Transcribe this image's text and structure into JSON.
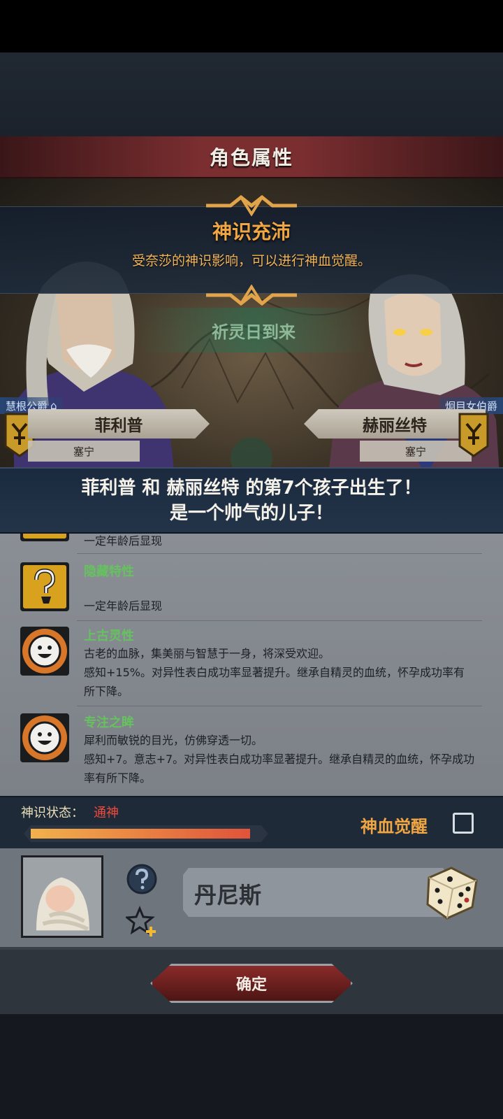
{
  "header": {
    "title": "角色属性"
  },
  "banner": {
    "title": "神识充沛",
    "subtitle": "受奈莎的神识影响，可以进行神血觉醒。"
  },
  "scene": {
    "prayer_label": "祈灵日到来"
  },
  "father": {
    "title": "慧根公爵",
    "name": "菲利普",
    "location": "塞宁"
  },
  "mother": {
    "title": "炯目女伯爵",
    "name": "赫丽丝特",
    "location": "塞宁"
  },
  "announcement": {
    "line1": "菲利普 和 赫丽丝特 的第7个孩子出生了！",
    "line2": "是一个帅气的儿子！"
  },
  "traits": [
    {
      "name": "",
      "icon": "question-icon",
      "desc": "一定年龄后显现"
    },
    {
      "name": "隐藏特性",
      "icon": "question-icon",
      "desc": "一定年龄后显现"
    },
    {
      "name": "上古灵性",
      "icon": "smile-sun-icon",
      "desc": "古老的血脉，集美丽与智慧于一身，将深受欢迎。\n感知+15%。对异性表白成功率显著提升。继承自精灵的血统，怀孕成功率有所下降。"
    },
    {
      "name": "专注之眸",
      "icon": "smile-sun-icon",
      "desc": "犀利而敏锐的目光，仿佛穿透一切。\n感知+7。意志+7。对异性表白成功率显著提升。继承自精灵的血统，怀孕成功率有所下降。"
    }
  ],
  "status": {
    "label": "神识状态：",
    "value": "通神",
    "progress": 0.95,
    "awaken_label": "神血觉醒",
    "awaken_checked": false
  },
  "child": {
    "name": "丹尼斯"
  },
  "footer": {
    "confirm_label": "确定"
  },
  "colors": {
    "accent_orange": "#f0a642",
    "trait_green": "#66c25e",
    "status_red": "#f04a3c"
  }
}
